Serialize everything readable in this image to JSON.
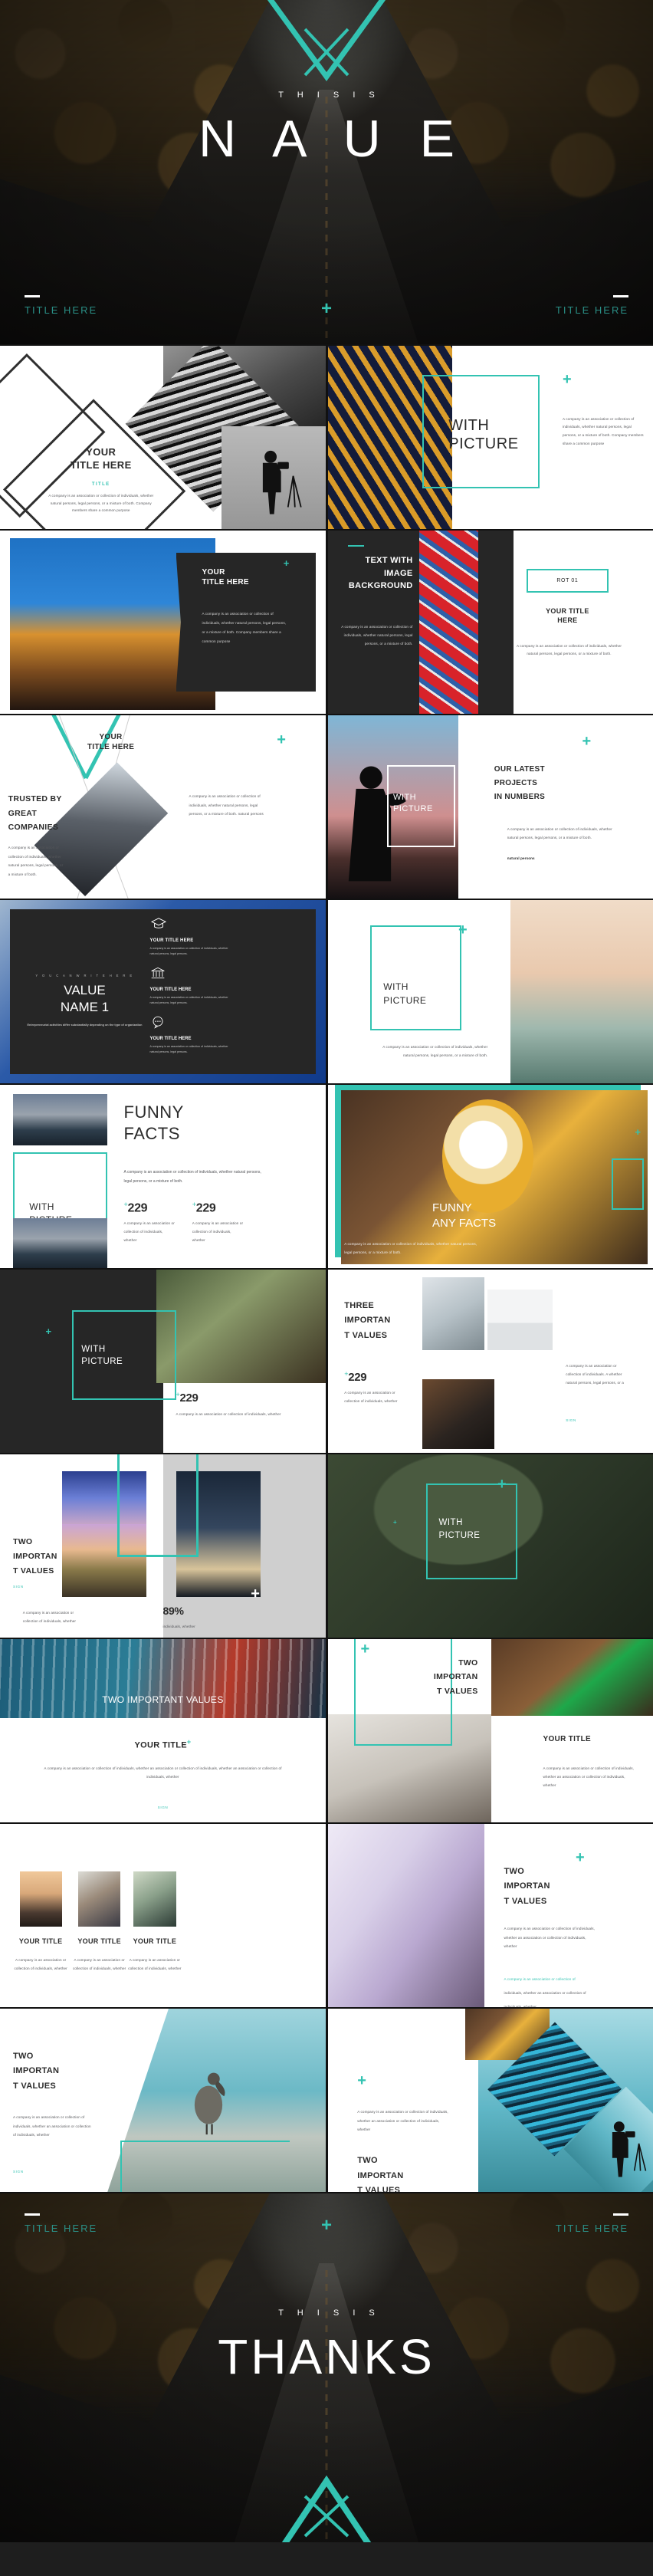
{
  "accent": "#33c3b2",
  "dark": "#262626",
  "hero": {
    "kicker": "T H I S   I S",
    "title": "N A U E",
    "footer_left": "TITLE HERE",
    "footer_right": "TITLE HERE",
    "plus": "+"
  },
  "body_text": {
    "full": "A company is an association or collection of individuals, whether natural persons, legal persons, or a mixture of both. Company members share a common purpose",
    "mid": "A company is an association or collection of individuals, whether natural persons, legal persons, or a mixture of both.",
    "short": "A company is an association or collection of individuals, whether",
    "two_line": "A company is an association or collection of individuals, whether an association or collection of individuals, whether",
    "legal": "A company is an association or collection of individuals, whether natural persons, legal persons, or a mixture of both. natural persons",
    "tiny": "A company is an association or collection of individuals, whether natural persons, legal persons."
  },
  "sign": "SIGN",
  "slides": [
    {
      "id": "diamond-collage",
      "title": "YOUR\nTITLE HERE",
      "kicker": "TITLE",
      "body": "A company is an association or collection of individuals, whether natural persons, legal persons, or a mixture of both. Company members share a common purpose"
    },
    {
      "id": "with-picture-bridge",
      "title": "WITH\nPICTURE",
      "body": "A company is an association or collection of individuals, whether natural persons, legal persons, or a mixture of both. Company members share a common purpose"
    },
    {
      "id": "dark-card-house",
      "title": "YOUR\nTITLE HERE",
      "body": "A company is an association or collection of individuals, whether natural persons, legal persons, or a mixture of both. Company members share a common purpose"
    },
    {
      "id": "text-with-image-background",
      "title": "TEXT WITH\nIMAGE\nBACKGROUND",
      "body": "A company is an association or collection of individuals, whether natural persons, legal persons, or a mixture of both.",
      "badge": "ROT 01",
      "subtitle": "YOUR TITLE\nHERE",
      "subbody": "A company is an association or collection of individuals, whether natural persons, legal persons, or a mixture of both."
    },
    {
      "id": "trusted-by-great-companies",
      "title": "YOUR\nTITLE HERE",
      "heading": "TRUSTED BY\nGREAT\nCOMPANIES",
      "body": "A company is an association or collection of individuals, whether natural persons, legal persons, or a mixture of both.",
      "body2": "A company is an association or collection of individuals, whether natural persons, legal persons, or a mixture of both. natural persons"
    },
    {
      "id": "our-latest-projects-in-numbers",
      "overlay_title": "WITH\nPICTURE",
      "heading": "OUR LATEST\nPROJECTS\nIN NUMBERS",
      "body": "A company is an association or collection of individuals, whether natural persons, legal persons, or a mixture of both.",
      "body_accent": "natural persons"
    },
    {
      "id": "value-name-icons",
      "kicker": "Y O U  C A N  W R I T E  H E R E",
      "title": "VALUE\nNAME 1",
      "sub": "Entrepreneurial activities differ substantially depending on the type of organization",
      "items": [
        {
          "icon": "graduation-cap-icon",
          "title": "YOUR TITLE HERE",
          "body": "A company is an association or collection of individuals, whether natural persons, legal persons."
        },
        {
          "icon": "bank-icon",
          "title": "YOUR TITLE HERE",
          "body": "A company is an association or collection of individuals, whether natural persons, legal persons."
        },
        {
          "icon": "chat-bubble-icon",
          "title": "YOUR TITLE HERE",
          "body": "A company is an association or collection of individuals, whether natural persons, legal persons."
        }
      ]
    },
    {
      "id": "with-picture-bridge-city",
      "title": "WITH\nPICTURE",
      "body": "A company is an association or collection of individuals, whether natural persons, legal persons, or a mixture of both."
    },
    {
      "id": "funny-facts",
      "title": "FUNNY\nFACTS",
      "overlay_title": "WITH\nPICTURE",
      "body": "A company is an association or collection of individuals, whether natural persons, legal persons, or a mixture of both.",
      "stats": [
        {
          "value": "229",
          "sup": "+",
          "body": "A company is an association or collection of individuals, whether"
        },
        {
          "value": "229",
          "sup": "+",
          "body": "A company is an association or collection of individuals, whether"
        }
      ]
    },
    {
      "id": "funny-any-facts",
      "title": "FUNNY\nANY FACTS",
      "body": "A company is an association or collection of individuals, whether natural persons, legal persons, or a mixture of both."
    },
    {
      "id": "with-picture-brushes",
      "title": "WITH\nPICTURE",
      "stat": {
        "value": "229",
        "sup": "+",
        "body": "A company is an association or collection of individuals, whether"
      }
    },
    {
      "id": "three-important-values",
      "title": "THREE\nIMPORTAN\nT VALUES",
      "stat": {
        "value": "229",
        "sup": "+",
        "body": "A company is an association or collection of individuals, whether"
      },
      "body": "A company is an association or collection of individuals. A whether natural persons, legal persons, or a",
      "sign": "SIGN"
    },
    {
      "id": "two-important-values-percent",
      "title": "TWO\nIMPORTAN\nT VALUES",
      "sign": "SIGN",
      "body": "A company is an association or collection of individuals, whether",
      "percent": "89%",
      "percent_body": "individuals, whether"
    },
    {
      "id": "with-picture-aerial",
      "title": "WITH\nPICTURE"
    },
    {
      "id": "two-important-values-race",
      "banner_title": "TWO IMPORTANT VALUES",
      "title": "YOUR TITLE",
      "body": "A company is an association or collection of individuals, whether an association or collection of individuals, whether an association or collection of individuals, whether",
      "sign": "SIGN"
    },
    {
      "id": "two-important-values-desk",
      "title": "TWO\nIMPORTAN\nT VALUES",
      "subtitle": "YOUR TITLE",
      "body": "A company is an association or collection of individuals, whether an association or collection of individuals, whether"
    },
    {
      "id": "team-three-people",
      "members": [
        {
          "title": "YOUR TITLE",
          "body": "A company is an association or collection of individuals, whether"
        },
        {
          "title": "YOUR TITLE",
          "body": "A company is an association or collection of individuals, whether"
        },
        {
          "title": "YOUR TITLE",
          "body": "A company is an association or collection of individuals, whether"
        }
      ]
    },
    {
      "id": "two-important-values-curve",
      "title": "TWO\nIMPORTAN\nT VALUES",
      "body": "A company is an association or collection of individuals, whether an association or collection of individuals, whether",
      "body_accent": "A company is an association or collection of",
      "body_accent_rest": "individuals, whether an association or collection of individuals, whether"
    },
    {
      "id": "two-important-values-pelican",
      "title": "TWO\nIMPORTAN\nT VALUES",
      "body": "A company is an association or collection of individuals, whether an association or collection of individuals, whether",
      "sign": "SIGN"
    },
    {
      "id": "two-important-values-diamonds",
      "body": "A company is an association or collection of individuals, whether an association or collection of individuals, whether",
      "title": "TWO\nIMPORTAN\nT VALUES"
    }
  ],
  "thanks": {
    "kicker": "T H I S   I S",
    "title": "THANKS",
    "footer_left": "TITLE HERE",
    "footer_right": "TITLE HERE",
    "plus": "+"
  }
}
